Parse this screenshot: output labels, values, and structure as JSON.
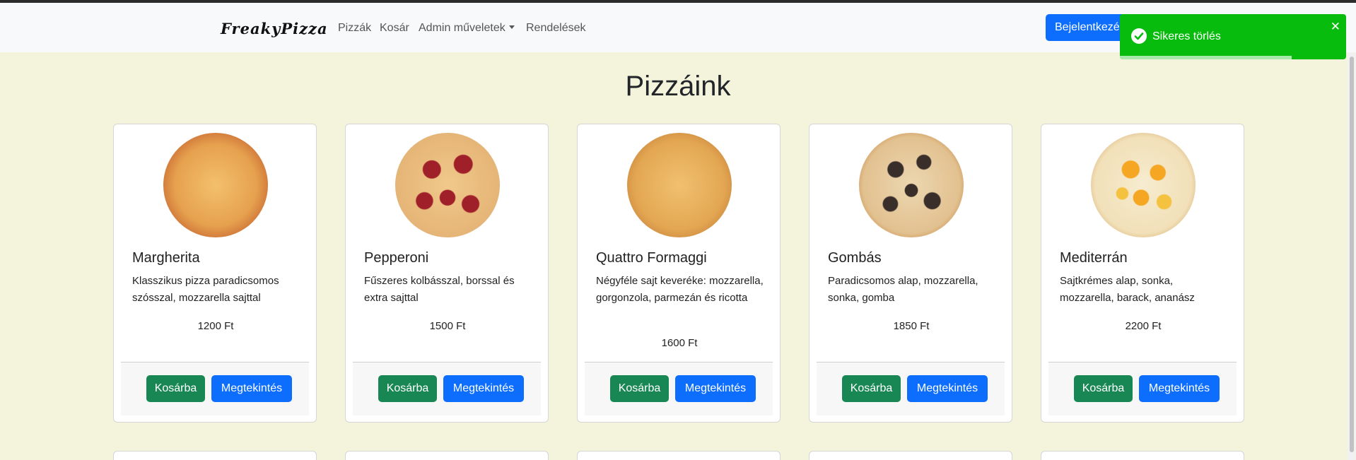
{
  "navbar": {
    "brand": "FreakyPizza",
    "links": [
      "Pizzák",
      "Kosár",
      "Admin műveletek",
      "Rendelések"
    ],
    "login_label": "Bejelentkezés"
  },
  "page": {
    "title": "Pizzáink"
  },
  "toast": {
    "message": "Sikeres törlés",
    "close": "✕",
    "progress": 0.76,
    "color": "#07bc0c"
  },
  "buttons": {
    "cart_label": "Kosárba",
    "view_label": "Megtekintés"
  },
  "pizzas": [
    {
      "name": "Margherita",
      "description": "Klasszikus pizza paradicsomos szósszal, mozzarella sajttal",
      "price": "1200 Ft"
    },
    {
      "name": "Pepperoni",
      "description": "Fűszeres kolbásszal, borssal és extra sajttal",
      "price": "1500 Ft"
    },
    {
      "name": "Quattro Formaggi",
      "description": "Négyféle sajt keveréke: mozzarella, gorgonzola, parmezán és ricotta",
      "price": "1600 Ft"
    },
    {
      "name": "Gombás",
      "description": "Paradicsomos alap, mozzarella, sonka, gomba",
      "price": "1850 Ft"
    },
    {
      "name": "Mediterrán",
      "description": "Sajtkrémes alap, sonka, mozzarella, barack, ananász",
      "price": "2200 Ft"
    }
  ]
}
